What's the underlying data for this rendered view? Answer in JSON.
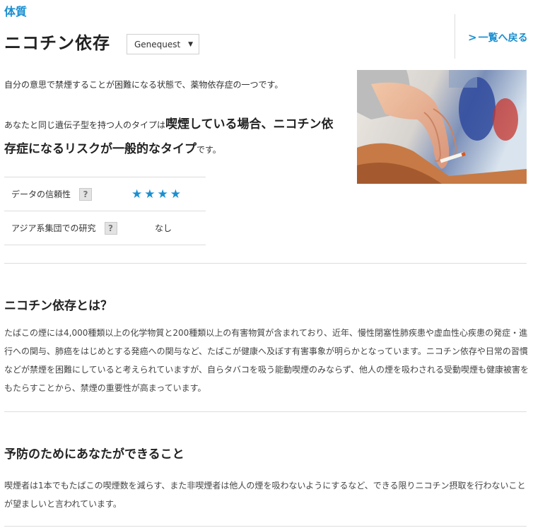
{
  "header": {
    "category": "体質",
    "title": "ニコチン依存",
    "source_select": {
      "value": "Genequest"
    },
    "back_link": "一覧へ戻る"
  },
  "summary": {
    "description": "自分の意思で禁煙することが困難になる状態で、薬物依存症の一つです。",
    "result_prefix": "あなたと同じ遺伝子型を持つ人のタイプは",
    "result_strong": "喫煙している場合、ニコチン依存症になるリスクが一般的なタイプ",
    "result_suffix": "です。"
  },
  "info_table": {
    "reliability_label": "データの信頼性",
    "reliability_stars": "★★★★",
    "reliability_value": 4,
    "asia_label": "アジア系集団での研究",
    "asia_value": "なし",
    "help_glyph": "?"
  },
  "sections": [
    {
      "heading": "ニコチン依存とは？",
      "body": "たばこの煙には4,000種類以上の化学物質と200種類以上の有害物質が含まれており、近年、慢性閉塞性肺疾患や虚血性心疾患の発症・進行への関与、肺癌をはじめとする発癌への関与など、たばこが健康へ及ぼす有害事象が明らかとなっています。ニコチン依存や日常の習慣などが禁煙を困難にしていると考えられていますが、自らタバコを吸う能動喫煙のみならず、他人の煙を吸わされる受動喫煙も健康被害をもたらすことから、禁煙の重要性が高まっています。"
    },
    {
      "heading": "予防のためにあなたができること",
      "body": "喫煙者は1本でもたばこの喫煙数を減らす、また非喫煙者は他人の煙を吸わないようにするなど、できる限りニコチン摂取を行わないことが望ましいと言われています。"
    }
  ],
  "colors": {
    "accent": "#1a8fd0",
    "divider": "#dddddd"
  },
  "icons": {
    "back": "chevron-right-icon",
    "help": "question-icon",
    "rating": "star-icon"
  }
}
